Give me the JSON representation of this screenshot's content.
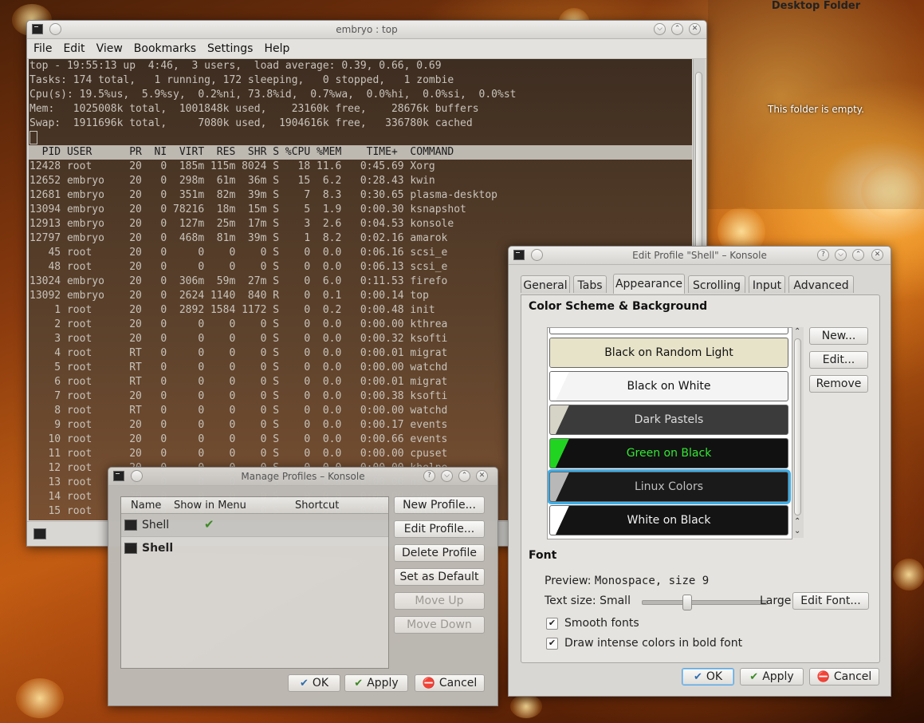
{
  "desktop_folder": {
    "title": "Desktop Folder",
    "empty_message": "This folder is empty."
  },
  "konsole": {
    "title": "embryo : top",
    "menu": [
      "File",
      "Edit",
      "View",
      "Bookmarks",
      "Settings",
      "Help"
    ],
    "summary": [
      "top - 19:55:13 up  4:46,  3 users,  load average: 0.39, 0.66, 0.69",
      "Tasks: 174 total,   1 running, 172 sleeping,   0 stopped,   1 zombie",
      "Cpu(s): 19.5%us,  5.9%sy,  0.2%ni, 73.8%id,  0.7%wa,  0.0%hi,  0.0%si,  0.0%st",
      "Mem:   1025008k total,  1001848k used,    23160k free,    28676k buffers",
      "Swap:  1911696k total,     7080k used,  1904616k free,   336780k cached"
    ],
    "header": "  PID USER      PR  NI  VIRT  RES  SHR S %CPU %MEM    TIME+  COMMAND",
    "processes": [
      "12428 root      20   0  185m 115m 8024 S   18 11.6   0:45.69 Xorg",
      "12652 embryo    20   0  298m  61m  36m S   15  6.2   0:28.43 kwin",
      "12681 embryo    20   0  351m  82m  39m S    7  8.3   0:30.65 plasma-desktop",
      "13094 embryo    20   0 78216  18m  15m S    5  1.9   0:00.30 ksnapshot",
      "12913 embryo    20   0  127m  25m  17m S    3  2.6   0:04.53 konsole",
      "12797 embryo    20   0  468m  81m  39m S    1  8.2   0:02.16 amarok",
      "   45 root      20   0     0    0    0 S    0  0.0   0:06.16 scsi_e",
      "   48 root      20   0     0    0    0 S    0  0.0   0:06.13 scsi_e",
      "13024 embryo    20   0  306m  59m  27m S    0  6.0   0:11.53 firefo",
      "13092 embryo    20   0  2624 1140  840 R    0  0.1   0:00.14 top",
      "    1 root      20   0  2892 1584 1172 S    0  0.2   0:00.48 init",
      "    2 root      20   0     0    0    0 S    0  0.0   0:00.00 kthrea",
      "    3 root      20   0     0    0    0 S    0  0.0   0:00.32 ksofti",
      "    4 root      RT   0     0    0    0 S    0  0.0   0:00.01 migrat",
      "    5 root      RT   0     0    0    0 S    0  0.0   0:00.00 watchd",
      "    6 root      RT   0     0    0    0 S    0  0.0   0:00.01 migrat",
      "    7 root      20   0     0    0    0 S    0  0.0   0:00.38 ksofti",
      "    8 root      RT   0     0    0    0 S    0  0.0   0:00.00 watchd",
      "    9 root      20   0     0    0    0 S    0  0.0   0:00.17 events",
      "   10 root      20   0     0    0    0 S    0  0.0   0:00.66 events",
      "   11 root      20   0     0    0    0 S    0  0.0   0:00.00 cpuset",
      "   12 root      20   0     0    0    0 S    0  0.0   0:00.00 khelpe",
      "   13 root      20   0     0    0    0 S    0  0.0   0:00.00 ns",
      "   14 root      20   0     0    0    0 S    0  0.0   0:00.00 sync_s",
      "   15 root      20   0     0    0    0 S    0  0.0   0:00.00 kblock"
    ]
  },
  "manage": {
    "title": "Manage Profiles – Konsole",
    "columns": {
      "name": "Name",
      "show": "Show in Menu",
      "shortcut": "Shortcut"
    },
    "rows": [
      {
        "name": "Shell",
        "checked": "✔"
      },
      {
        "name": "Shell"
      }
    ],
    "buttons": {
      "new": "New Profile...",
      "edit": "Edit Profile...",
      "delete": "Delete Profile",
      "default": "Set as Default",
      "up": "Move Up",
      "down": "Move Down",
      "ok": "OK",
      "apply": "Apply",
      "cancel": "Cancel"
    }
  },
  "edit": {
    "title": "Edit Profile \"Shell\" – Konsole",
    "tabs": [
      "General",
      "Tabs",
      "Appearance",
      "Scrolling",
      "Input",
      "Advanced"
    ],
    "color_section": "Color Scheme & Background",
    "schemes": [
      {
        "name": "Black on Random Light",
        "bg": "#e7e3c9",
        "fg": "#111111",
        "sw": "#e7e3c9"
      },
      {
        "name": "Black on White",
        "bg": "#f4f4f4",
        "fg": "#111111",
        "sw": "#ffffff"
      },
      {
        "name": "Dark Pastels",
        "bg": "#3b3b3b",
        "fg": "#dcdcdc",
        "sw": "#d6d4c6"
      },
      {
        "name": "Green on Black",
        "bg": "#111111",
        "fg": "#33e833",
        "sw": "#22d422"
      },
      {
        "name": "Linux Colors",
        "bg": "#1a1a1a",
        "fg": "#bfbfbf",
        "sw": "#b8b8b8"
      },
      {
        "name": "White on Black",
        "bg": "#141414",
        "fg": "#f2f2f2",
        "sw": "#ffffff"
      }
    ],
    "scheme_buttons": {
      "new": "New...",
      "edit": "Edit...",
      "remove": "Remove"
    },
    "font_section": "Font",
    "preview_label": "Preview:",
    "preview_value": "Monospace, size 9",
    "text_size_label": "Text size: Small",
    "large_label": "Large",
    "edit_font": "Edit Font...",
    "smooth_fonts": "Smooth fonts",
    "intense_bold": "Draw intense colors in bold font",
    "check_mark": "✔",
    "ok": "OK",
    "apply": "Apply",
    "cancel": "Cancel"
  }
}
